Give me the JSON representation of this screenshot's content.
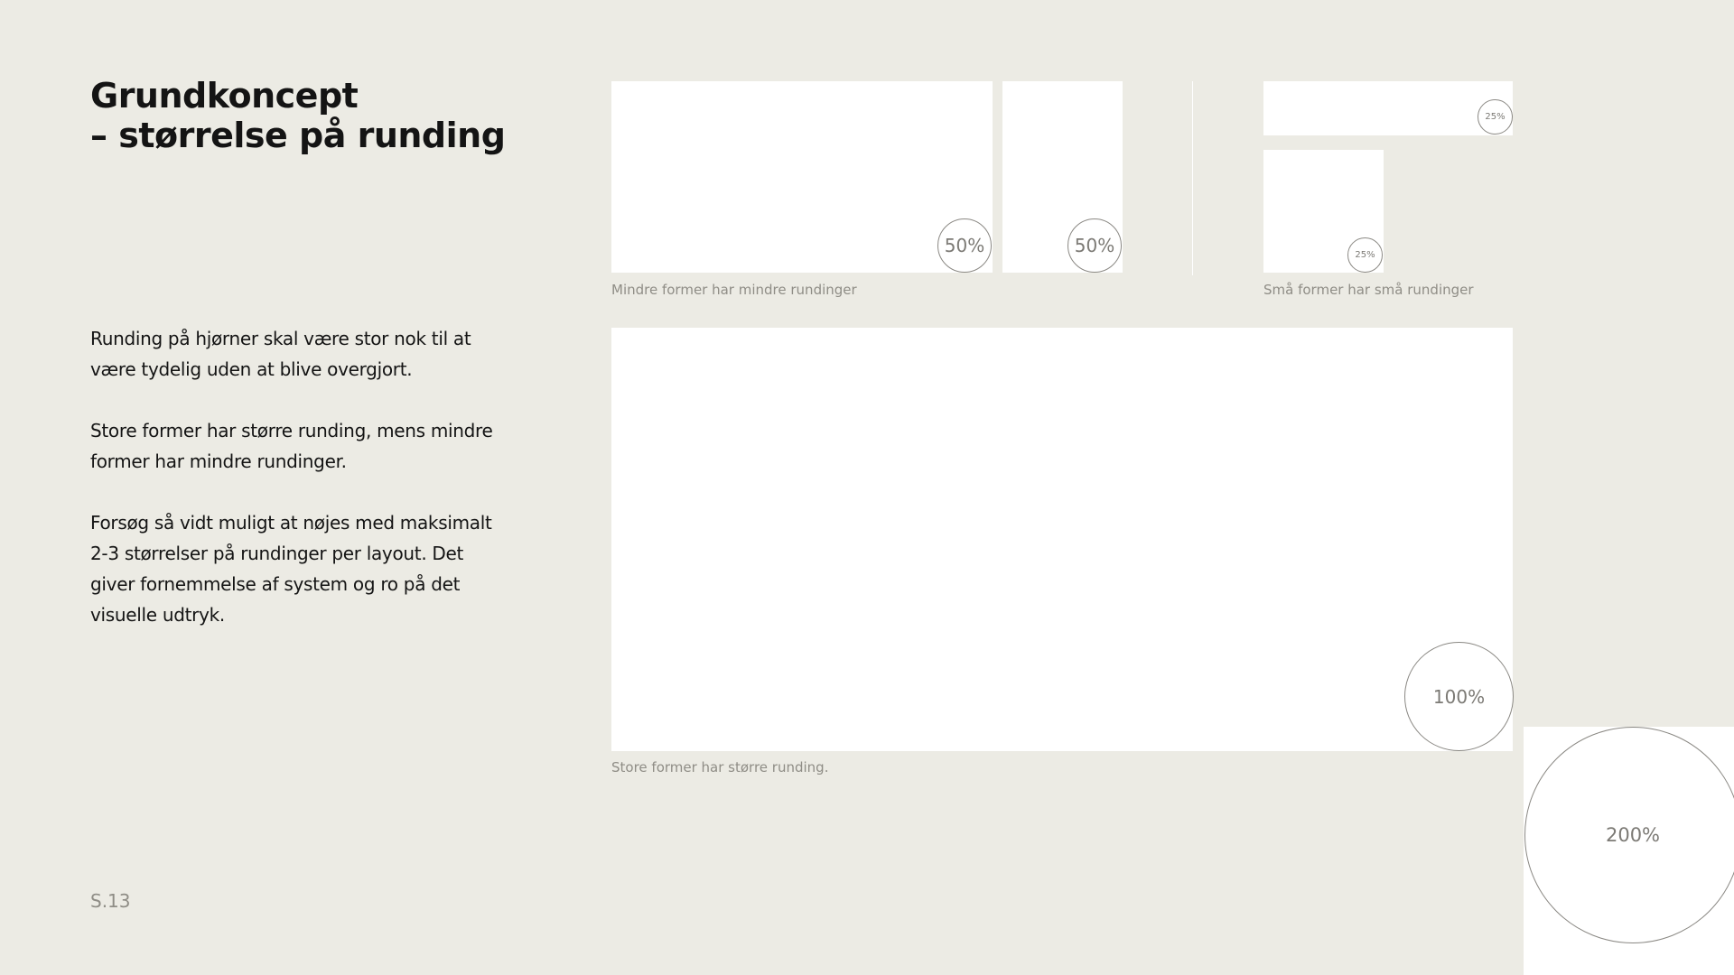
{
  "heading": {
    "line1": "Grundkoncept",
    "line2": "– størrelse på runding"
  },
  "body": {
    "paragraph1": "Runding på hjørner skal være stor nok til at være tydelig uden at blive overgjort.",
    "paragraph2": "Store former har større runding, mens mindre former har mindre rundinger.",
    "paragraph3": "Forsøg så vidt muligt at nøjes med maksimalt 2-3 størrelser på rundinger per layout. Det giver fornemmelse af system og ro på det visuelle udtryk."
  },
  "page_number": "S.13",
  "examples": {
    "medium": {
      "caption": "Mindre former har mindre rundinger",
      "wide_label": "50%",
      "narrow_label": "50%"
    },
    "small": {
      "caption": "Små former har små rundinger",
      "wide_label": "25%",
      "square_label": "25%"
    },
    "large": {
      "caption": "Store former har større runding.",
      "label": "100%"
    },
    "corner": {
      "label": "200%"
    }
  },
  "colors": {
    "background": "#ECEBE4",
    "card": "#FFFFFF",
    "text": "#141414",
    "muted_text": "#8F8D86",
    "circle_stroke": "#8A8883"
  }
}
